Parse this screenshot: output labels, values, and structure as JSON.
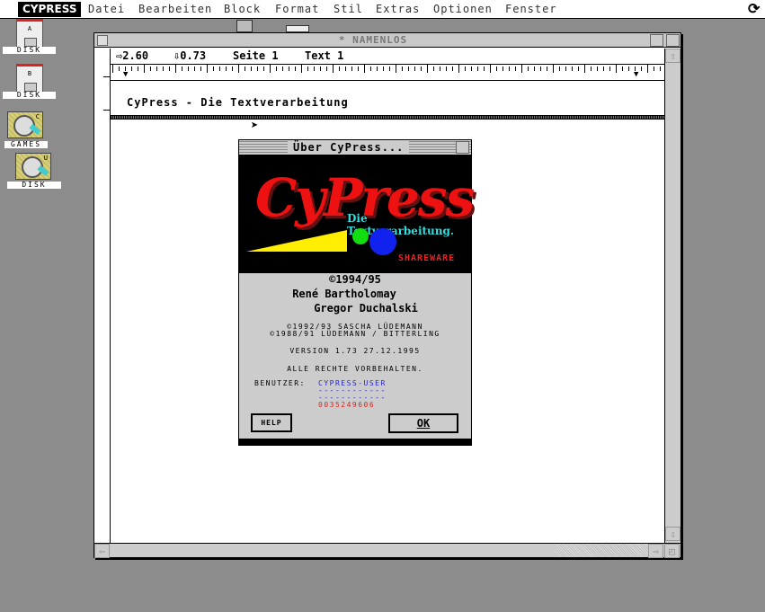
{
  "menubar": {
    "app": "CYPRESS",
    "items": [
      "Datei",
      "Bearbeiten",
      "Block",
      "Format",
      "Stil",
      "Extras",
      "Optionen",
      "Fenster"
    ]
  },
  "desktop": {
    "icons": [
      {
        "label": "DISK",
        "drive": "A",
        "type": "floppy"
      },
      {
        "label": "DISK",
        "drive": "B",
        "type": "floppy"
      },
      {
        "label": "GAMES",
        "drive": "C",
        "type": "harddisk"
      },
      {
        "label": "DISK",
        "drive": "U",
        "type": "harddisk"
      }
    ]
  },
  "window": {
    "title": "* NAMENLOS",
    "info": {
      "x": "⇨2.60",
      "y": "⇩0.73",
      "page": "Seite 1",
      "text": "Text 1"
    },
    "document_text": "CyPress - Die Textverarbeitung"
  },
  "dialog": {
    "title": "Über CyPress...",
    "logo": {
      "name": "CyPress",
      "tagline": "Die Textverarbeitung.",
      "badge": "SHAREWARE"
    },
    "copyright": "©1994/95",
    "authors": [
      "René Bartholomay",
      "Gregor Duchalski"
    ],
    "credits": [
      "©1992/93 SASCHA LÜDEMANN",
      "©1988/91 LÜDEMANN / BITTERLING"
    ],
    "version": "VERSION 1.73   27.12.1995",
    "rights": "ALLE RECHTE VORBEHALTEN.",
    "user_label": "BENUTZER:",
    "user_lines": [
      "CYPRESS-USER",
      "------------",
      "------------"
    ],
    "serial": "0035249606",
    "help_label": "HELP",
    "ok_label": "OK"
  },
  "colors": {
    "logo_red": "#ee1111",
    "tagline": "#33dddd",
    "user_blue": "#2222cc",
    "serial_red": "#dd2222"
  }
}
